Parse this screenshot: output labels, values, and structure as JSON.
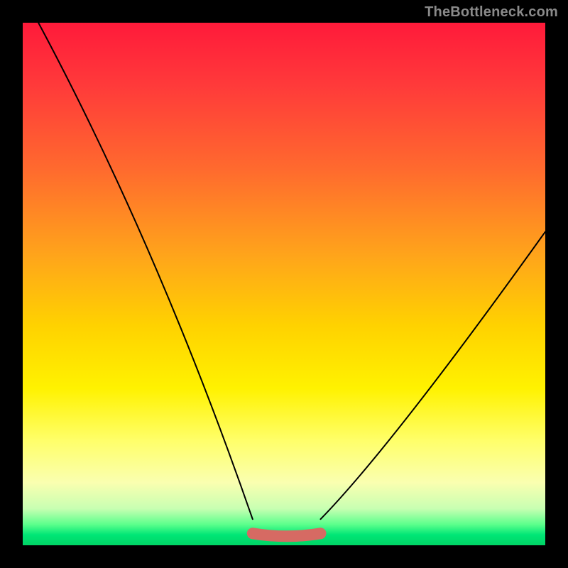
{
  "watermark": "TheBottleneck.com",
  "colors": {
    "frame_bg": "#000000",
    "gradient_top": "#ff1a3a",
    "gradient_bottom": "#00d465",
    "curve": "#000000",
    "plateau": "#d66a63",
    "watermark": "#8a8a8a"
  },
  "chart_data": {
    "type": "line",
    "title": "",
    "xlabel": "",
    "ylabel": "",
    "xlim": [
      0,
      100
    ],
    "ylim": [
      0,
      100
    ],
    "left_curve_start_x": 3,
    "left_curve_start_y": 100,
    "right_curve_end_x": 100,
    "right_curve_end_y": 60,
    "plateau_x_range": [
      44,
      57
    ],
    "plateau_y": 2,
    "series": [
      {
        "name": "left-descent",
        "x": [
          3,
          8,
          14,
          20,
          26,
          32,
          38,
          44
        ],
        "values": [
          100,
          88,
          75,
          62,
          49,
          36,
          22,
          5
        ]
      },
      {
        "name": "plateau",
        "x": [
          44,
          48,
          52,
          57
        ],
        "values": [
          2,
          1.5,
          1.5,
          2
        ]
      },
      {
        "name": "right-ascent",
        "x": [
          57,
          63,
          70,
          78,
          86,
          93,
          100
        ],
        "values": [
          5,
          13,
          23,
          34,
          44,
          53,
          60
        ]
      }
    ]
  }
}
